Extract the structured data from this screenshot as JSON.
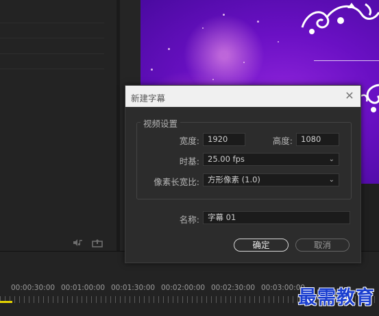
{
  "dialog": {
    "title": "新建字幕",
    "close_glyph": "✕",
    "video_settings": {
      "legend": "视频设置",
      "width_label": "宽度:",
      "width_value": "1920",
      "height_label": "高度:",
      "height_value": "1080",
      "timebase_label": "时基:",
      "timebase_value": "25.00 fps",
      "pixel_aspect_label": "像素长宽比:",
      "pixel_aspect_value": "方形像素 (1.0)"
    },
    "name_label": "名称:",
    "name_value": "字幕 01",
    "ok_label": "确定",
    "cancel_label": "取消"
  },
  "timeline": {
    "timecodes": [
      "00:00:30:00",
      "00:01:00:00",
      "00:01:30:00",
      "00:02:00:00",
      "00:02:30:00",
      "00:03:00:00"
    ]
  },
  "watermark": "最需教育",
  "colors": {
    "dialog_bg": "#2c2c2c",
    "titlebar_bg": "#f0f0f0",
    "playhead": "#e8d600",
    "watermark": "#1b3fd0"
  }
}
